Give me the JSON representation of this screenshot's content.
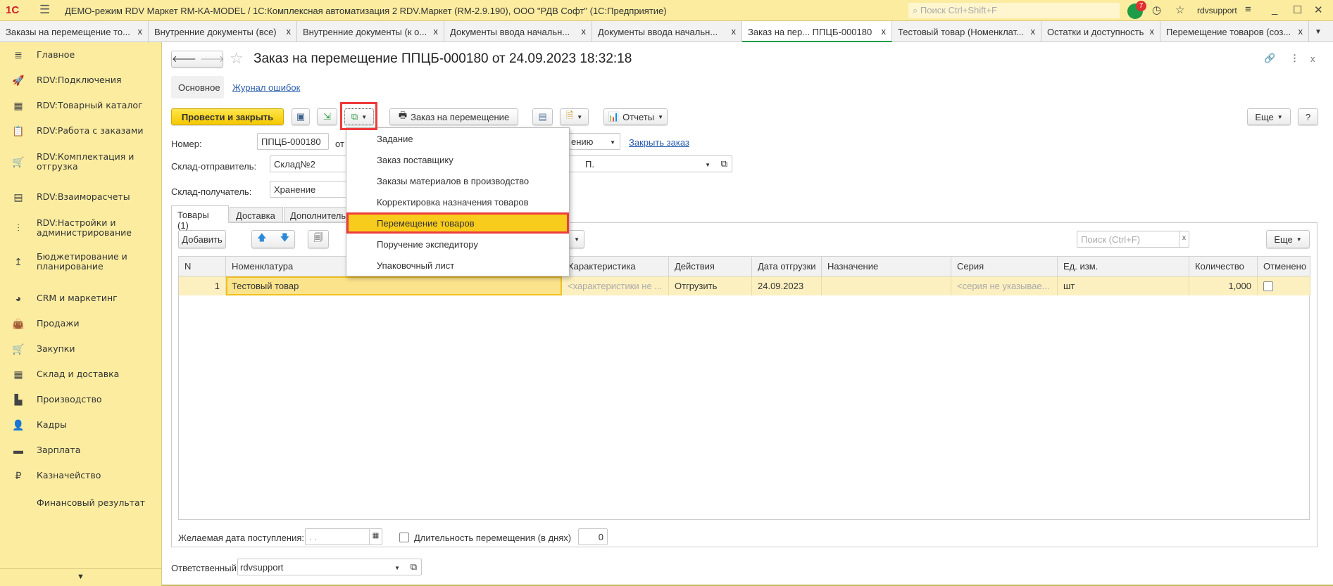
{
  "window": {
    "title": "ДЕМО-режим RDV Маркет RM-KA-MODEL / 1С:Комплексная автоматизация 2 RDV.Маркет (RM-2.9.190), ООО \"РДВ Софт\"  (1С:Предприятие)",
    "logo": "1С",
    "search_placeholder": "Поиск Ctrl+Shift+F",
    "notifications": "7",
    "user": "rdvsupport"
  },
  "tabs": [
    {
      "label": "Заказы на перемещение то..."
    },
    {
      "label": "Внутренние документы (все)"
    },
    {
      "label": "Внутренние документы (к о..."
    },
    {
      "label": "Документы ввода начальн..."
    },
    {
      "label": "Документы ввода начальн..."
    },
    {
      "label": "Заказ на пер...  ППЦБ-000180"
    },
    {
      "label": "Тестовый товар (Номенклат..."
    },
    {
      "label": "Остатки и доступность"
    },
    {
      "label": "Перемещение товаров (соз..."
    }
  ],
  "sidebar": {
    "items": [
      {
        "label": "Главное",
        "icon": "≣"
      },
      {
        "label": "RDV:Подключения",
        "icon": "🚀"
      },
      {
        "label": "RDV:Товарный каталог",
        "icon": "▦"
      },
      {
        "label": "RDV:Работа с заказами",
        "icon": "📋"
      },
      {
        "label": "RDV:Комплектация и отгрузка",
        "icon": "🛒"
      },
      {
        "label": "RDV:Взаиморасчеты",
        "icon": "▤"
      },
      {
        "label": "RDV:Настройки и администрирование",
        "icon": "⫶"
      },
      {
        "label": "Бюджетирование и планирование",
        "icon": "↥"
      },
      {
        "label": "CRM и маркетинг",
        "icon": "◕"
      },
      {
        "label": "Продажи",
        "icon": "👜"
      },
      {
        "label": "Закупки",
        "icon": "🛒"
      },
      {
        "label": "Склад и доставка",
        "icon": "▦"
      },
      {
        "label": "Производство",
        "icon": "▙"
      },
      {
        "label": "Кадры",
        "icon": "👤"
      },
      {
        "label": "Зарплата",
        "icon": "▬"
      },
      {
        "label": "Казначейство",
        "icon": "₽"
      },
      {
        "label": "Финансовый результат и",
        "icon": ""
      }
    ]
  },
  "form": {
    "title": "Заказ на перемещение ППЦБ-000180 от 24.09.2023 18:32:18",
    "subtabs": {
      "main": "Основное",
      "log": "Журнал ошибок"
    },
    "toolbar": {
      "post_close": "Провести и закрыть",
      "print_order": "Заказ на перемещение",
      "reports": "Отчеты",
      "more": "Еще",
      "help": "?"
    },
    "fields": {
      "number_label": "Номер:",
      "number": "ППЦБ-000180",
      "from_label": "от",
      "status_tail": "ению",
      "close_order": "Закрыть заказ",
      "sender_label": "Склад-отправитель:",
      "sender": "Склад№2",
      "sender_right": "П.",
      "receiver_label": "Склад-получатель:",
      "receiver": "Хранение"
    },
    "pagetabs": [
      "Товары (1)",
      "Доставка",
      "Дополнитель"
    ],
    "grid_toolbar": {
      "add": "Добавить",
      "search_placeholder": "Поиск (Ctrl+F)",
      "more": "Еще"
    },
    "columns": [
      "N",
      "Номенклатура",
      "Характеристика",
      "Действия",
      "Дата отгрузки",
      "Назначение",
      "Серия",
      "Ед. изм.",
      "Количество",
      "Отменено"
    ],
    "rows": [
      {
        "n": "1",
        "item": "Тестовый товар",
        "char": "<характеристики не ...",
        "action": "Отгрузить",
        "date": "24.09.2023",
        "purpose": "",
        "series": "<серия не указывае...",
        "unit": "шт",
        "qty": "1,000"
      }
    ],
    "bottom": {
      "desired_date_label": "Желаемая дата поступления:",
      "desired_date": " .  .",
      "duration_label": "Длительность перемещения (в днях)",
      "duration": "0",
      "responsible_label": "Ответственный:",
      "responsible": "rdvsupport"
    }
  },
  "menu": {
    "items": [
      "Задание",
      "Заказ поставщику",
      "Заказы материалов в производство",
      "Корректировка назначения товаров",
      "Перемещение товаров",
      "Поручение экспедитору",
      "Упаковочный лист"
    ],
    "selected": 4
  }
}
